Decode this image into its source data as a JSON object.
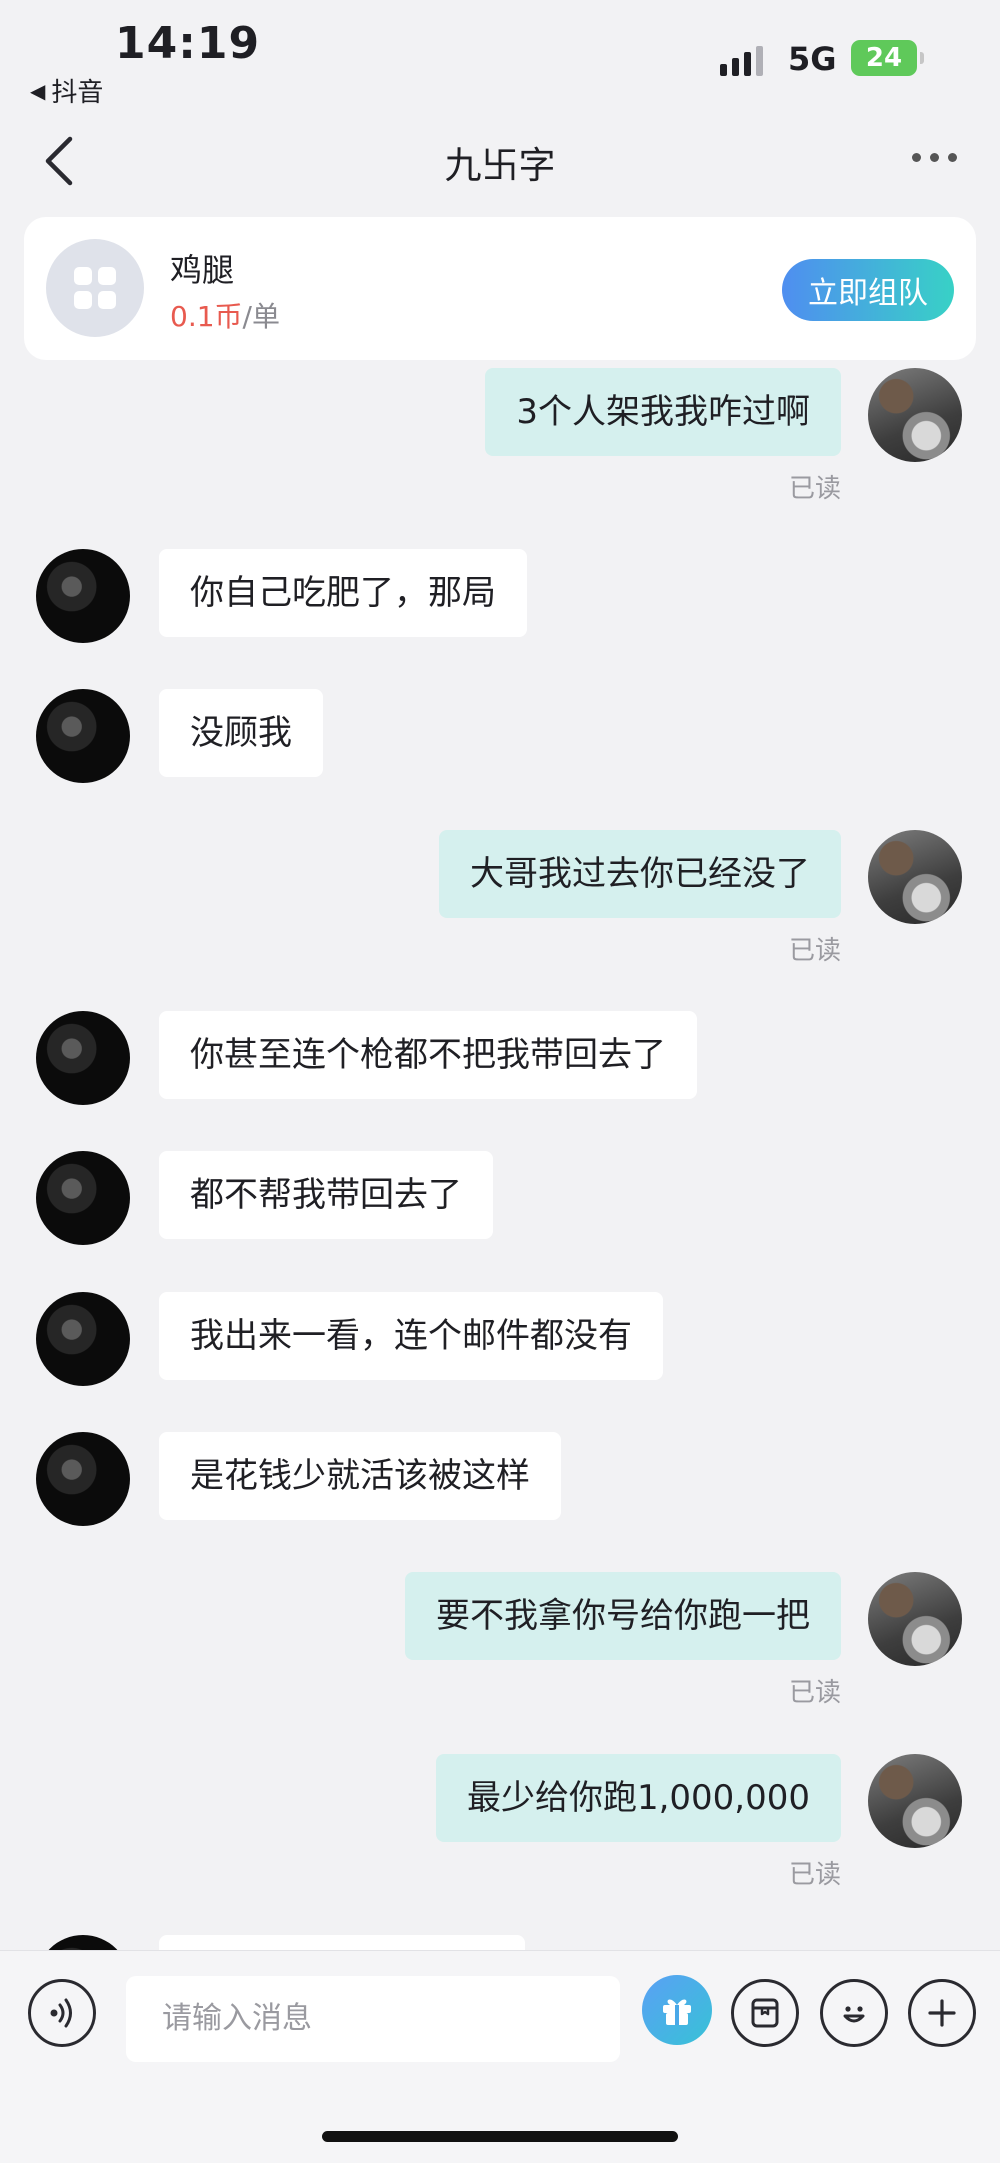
{
  "status_bar": {
    "time": "14:19",
    "back_app": "抖音",
    "network": "5G",
    "battery": "24"
  },
  "nav": {
    "title": "九卐字"
  },
  "product_card": {
    "name": "鸡腿",
    "price_value": "0.1币",
    "price_unit": "/单",
    "action_label": "立即组队"
  },
  "messages": [
    {
      "side": "out",
      "text": "3个人架我我咋过啊",
      "status": "已读"
    },
    {
      "side": "in",
      "text": "你自己吃肥了，那局"
    },
    {
      "side": "in",
      "text": "没顾我"
    },
    {
      "side": "out",
      "text": "大哥我过去你已经没了",
      "status": "已读"
    },
    {
      "side": "in",
      "text": "你甚至连个枪都不把我带回去了"
    },
    {
      "side": "in",
      "text": "都不帮我带回去了"
    },
    {
      "side": "in",
      "text": "我出来一看，连个邮件都没有"
    },
    {
      "side": "in",
      "text": "是花钱少就活该被这样"
    },
    {
      "side": "out",
      "text": "要不我拿你号给你跑一把",
      "status": "已读"
    },
    {
      "side": "out",
      "text": "最少给你跑1,000,000",
      "status": "已读"
    }
  ],
  "input_bar": {
    "placeholder": "请输入消息"
  },
  "colors": {
    "background": "#f2f2f4",
    "outgoing_bubble": "#d5f0ee",
    "incoming_bubble": "#ffffff",
    "price_red": "#e85a4f",
    "button_gradient_start": "#4f8ef0",
    "button_gradient_end": "#38d1c6"
  },
  "icons": [
    "back-chevron-icon",
    "more-icon",
    "grid-icon",
    "voice-icon",
    "gift-icon",
    "sticker-box-icon",
    "emoji-icon",
    "plus-icon"
  ]
}
